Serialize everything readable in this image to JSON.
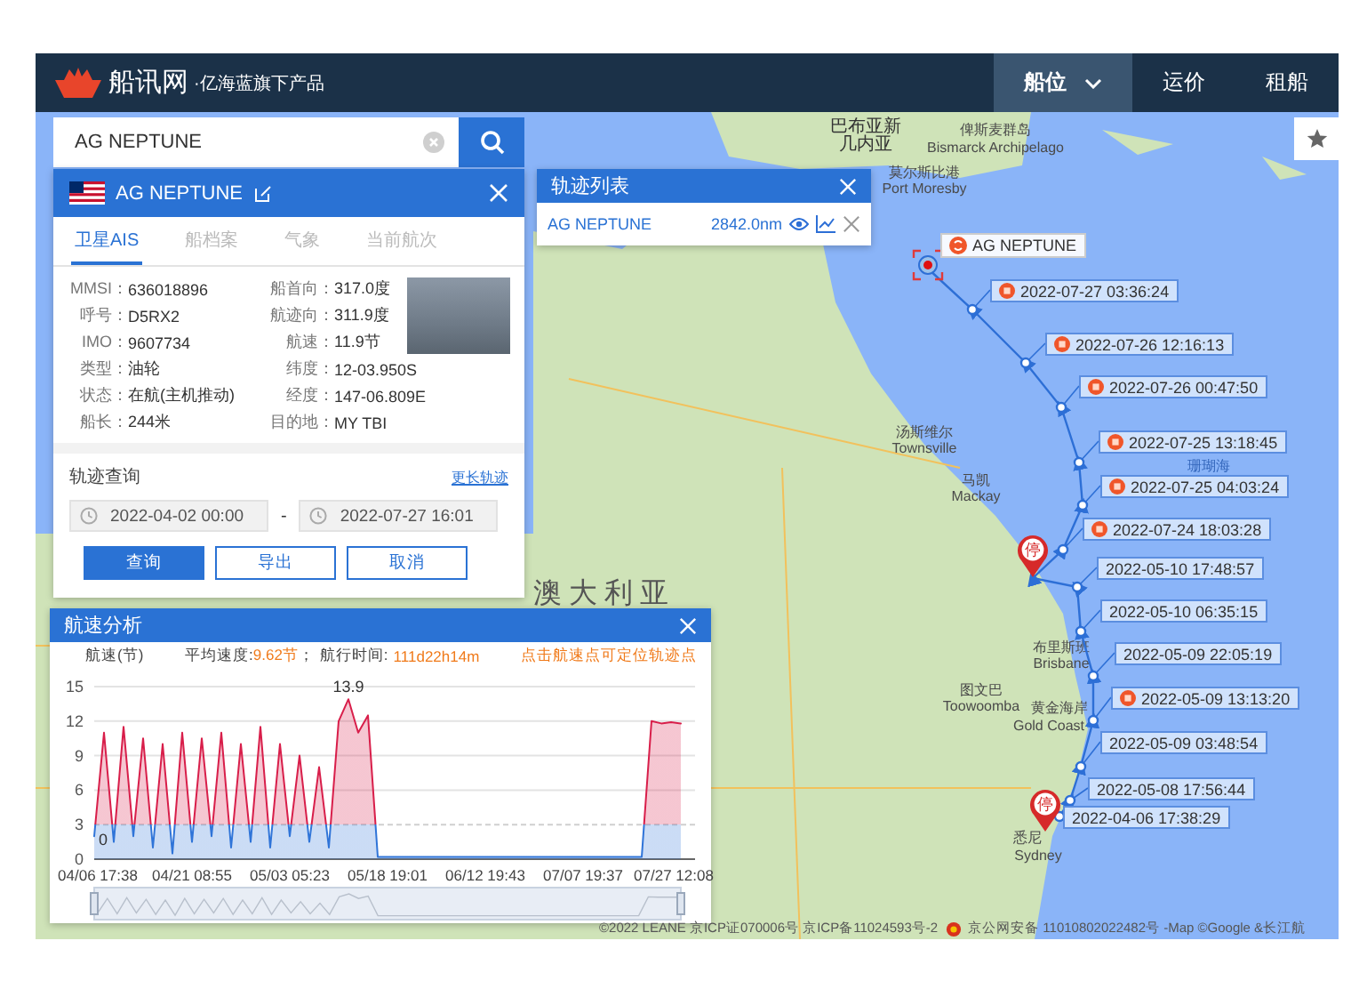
{
  "header": {
    "logo_name": "船讯网",
    "logo_tagline": "·亿海蓝旗下产品",
    "nav": [
      {
        "label": "船位",
        "selected": true,
        "dropdown": true
      },
      {
        "label": "运价",
        "selected": false,
        "dropdown": false
      },
      {
        "label": "租船",
        "selected": false,
        "dropdown": false
      }
    ]
  },
  "search": {
    "value": "AG NEPTUNE"
  },
  "ship_panel": {
    "name": "AG NEPTUNE",
    "tabs": [
      {
        "label": "卫星AIS",
        "selected": true
      },
      {
        "label": "船档案",
        "selected": false
      },
      {
        "label": "气象",
        "selected": false
      },
      {
        "label": "当前航次",
        "selected": false
      }
    ],
    "fields_left": [
      {
        "label": "MMSI：",
        "value": "636018896"
      },
      {
        "label": "呼号：",
        "value": "D5RX2"
      },
      {
        "label": "IMO：",
        "value": "9607734"
      },
      {
        "label": "类型：",
        "value": "油轮"
      },
      {
        "label": "状态：",
        "value": "在航(主机推动)"
      },
      {
        "label": "船长：",
        "value": "244米"
      }
    ],
    "fields_right": [
      {
        "label": "船首向：",
        "value": "317.0度"
      },
      {
        "label": "航迹向：",
        "value": "311.9度"
      },
      {
        "label": "航速：",
        "value": "11.9节"
      },
      {
        "label": "纬度：",
        "value": "12-03.950S"
      },
      {
        "label": "经度：",
        "value": "147-06.809E"
      },
      {
        "label": "目的地：",
        "value": "MY TBI"
      }
    ]
  },
  "track_query": {
    "title": "轨迹查询",
    "link": "更长轨迹",
    "start": "2022-04-02 00:00",
    "separator": "-",
    "end": "2022-07-27 16:01",
    "buttons": [
      {
        "label": "查询",
        "kind": "primary"
      },
      {
        "label": "导出",
        "kind": "outline"
      },
      {
        "label": "取消",
        "kind": "outline"
      }
    ]
  },
  "track_list": {
    "title": "轨迹列表",
    "rows": [
      {
        "name": "AG NEPTUNE",
        "distance": "2842.0nm"
      }
    ]
  },
  "map": {
    "labels": [
      {
        "text": "巴布亚新",
        "kind": "country"
      },
      {
        "text": "几内亚",
        "kind": "country"
      },
      {
        "text": "俾斯麦群岛",
        "kind": "place"
      },
      {
        "text": "Bismarck Archipelago",
        "kind": "place"
      },
      {
        "text": "莫尔斯比港",
        "kind": "place"
      },
      {
        "text": "Port Moresby",
        "kind": "place"
      },
      {
        "text": "珊瑚海",
        "kind": "sea"
      },
      {
        "text": "汤斯维尔",
        "kind": "place"
      },
      {
        "text": "Townsville",
        "kind": "place"
      },
      {
        "text": "马凯",
        "kind": "place"
      },
      {
        "text": "Mackay",
        "kind": "place"
      },
      {
        "text": "布里斯班",
        "kind": "place"
      },
      {
        "text": "Brisbane",
        "kind": "place"
      },
      {
        "text": "图文巴",
        "kind": "place"
      },
      {
        "text": "Toowoomba",
        "kind": "place"
      },
      {
        "text": "黄金海岸",
        "kind": "place"
      },
      {
        "text": "Gold Coast",
        "kind": "place"
      },
      {
        "text": "悉尼",
        "kind": "place"
      },
      {
        "text": "Sydney",
        "kind": "place"
      },
      {
        "text": "澳大利亚",
        "kind": "big"
      }
    ],
    "ship_label": "AG NEPTUNE",
    "track_points": [
      {
        "time": "2022-07-27 03:36:24",
        "alert": true
      },
      {
        "time": "2022-07-26 12:16:13",
        "alert": true
      },
      {
        "time": "2022-07-26 00:47:50",
        "alert": true
      },
      {
        "time": "2022-07-25 13:18:45",
        "alert": true
      },
      {
        "time": "2022-07-25 04:03:24",
        "alert": true
      },
      {
        "time": "2022-07-24 18:03:28",
        "alert": true
      },
      {
        "time": "2022-05-10 17:48:57",
        "alert": false
      },
      {
        "time": "2022-05-10 06:35:15",
        "alert": false
      },
      {
        "time": "2022-05-09 22:05:19",
        "alert": false
      },
      {
        "time": "2022-05-09 13:13:20",
        "alert": true
      },
      {
        "time": "2022-05-09 03:48:54",
        "alert": false
      },
      {
        "time": "2022-05-08 17:56:44",
        "alert": false
      },
      {
        "time": "2022-04-06 17:38:29",
        "alert": false
      }
    ],
    "stop_pins": [
      "停",
      "停"
    ],
    "footer": {
      "left": "©2022 LEANE  京ICP证070006号  京ICP备11024593号-2",
      "right": "京公网安备 11010802022482号  -Map ©Google &长江航"
    }
  },
  "speed_panel": {
    "title": "航速分析",
    "avg_label": "平均速度:",
    "avg_value": "9.62节",
    "sep": "；",
    "time_label": "航行时间:",
    "time_value": "111d22h14m",
    "hint": "点击航速点可定位轨迹点",
    "chart_data": {
      "type": "area",
      "ylabel": "航速(节)",
      "grid": true,
      "ref_lines": [
        {
          "axis": "y",
          "value": 3
        }
      ],
      "categories": [
        "04/06 17:38",
        null,
        null,
        null,
        null,
        null,
        null,
        null,
        null,
        null,
        "04/21 08:55",
        null,
        null,
        null,
        null,
        null,
        null,
        null,
        null,
        null,
        "05/03 05:23",
        null,
        null,
        null,
        null,
        null,
        null,
        null,
        null,
        null,
        "05/18 19:01",
        null,
        null,
        null,
        null,
        null,
        null,
        null,
        null,
        null,
        "06/12 19:43",
        null,
        null,
        null,
        null,
        null,
        null,
        null,
        null,
        null,
        "07/07 19:37",
        null,
        null,
        null,
        null,
        null,
        null,
        null,
        null,
        null,
        "07/27 12:08"
      ],
      "series": [
        {
          "color": "#d81e4a",
          "values": [
            2,
            11,
            1.5,
            11.5,
            2,
            10.5,
            1,
            10,
            0.5,
            11,
            1.5,
            10.5,
            2,
            11,
            1,
            10,
            1.5,
            11.5,
            1,
            10,
            2,
            9,
            1.5,
            8,
            1,
            12,
            13.9,
            11,
            12.5,
            0.2,
            0.2,
            0.2,
            0.2,
            0.2,
            0.2,
            0.2,
            0.2,
            0.2,
            0.2,
            0.2,
            0.2,
            0.2,
            0.2,
            0.2,
            0.2,
            0.2,
            0.2,
            0.2,
            0.2,
            0.2,
            0.2,
            0.2,
            0.2,
            0.2,
            0.2,
            0.2,
            0.2,
            12,
            11.8,
            11.9,
            11.8
          ]
        }
      ],
      "ylim": [
        0,
        15
      ],
      "yticks": [
        0,
        3,
        6,
        9,
        12,
        15
      ],
      "annotations": [
        {
          "y": 13.9,
          "text": "13.9"
        },
        "0"
      ]
    }
  }
}
